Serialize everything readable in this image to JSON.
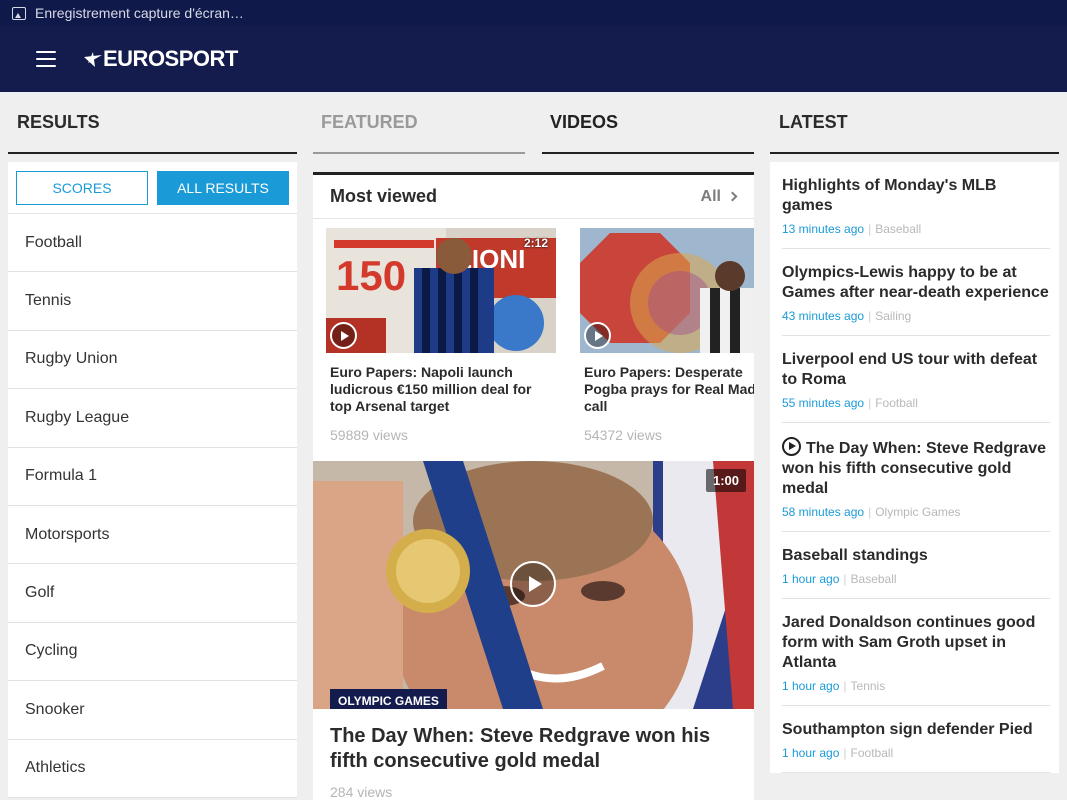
{
  "statusbar": {
    "text": "Enregistrement capture d'écran…",
    "icon": "image-icon"
  },
  "appbar": {
    "logo": "EUROSPORT",
    "menu_icon": "hamburger-menu-icon",
    "color": "#141b4d"
  },
  "results": {
    "heading": "RESULTS",
    "scores_label": "SCORES",
    "all_results_label": "ALL RESULTS",
    "sports": [
      "Football",
      "Tennis",
      "Rugby Union",
      "Rugby League",
      "Formula 1",
      "Motorsports",
      "Golf",
      "Cycling",
      "Snooker",
      "Athletics"
    ]
  },
  "tabs": {
    "featured": "FEATURED",
    "videos": "VIDEOS"
  },
  "most_viewed": {
    "title": "Most viewed",
    "all_label": "All",
    "items": [
      {
        "duration": "2:12",
        "caption": "Euro Papers: Napoli launch ludicrous €150 million deal for top Arsenal target",
        "views": "59889 views"
      },
      {
        "caption": "Euro Papers: Desperate Pogba prays for Real Madrid call",
        "views": "54372 views"
      }
    ]
  },
  "featured_video": {
    "duration": "1:00",
    "category": "OLYMPIC GAMES",
    "title": "The Day When: Steve Redgrave won his fifth consecutive gold medal",
    "views": "284 views"
  },
  "latest": {
    "heading": "LATEST",
    "items": [
      {
        "title": "Highlights of Monday's MLB games",
        "time": "13 minutes ago",
        "category": "Baseball",
        "video": false
      },
      {
        "title": "Olympics-Lewis happy to be at Games after near-death experience",
        "time": "43 minutes ago",
        "category": "Sailing",
        "video": false
      },
      {
        "title": "Liverpool end US tour with defeat to Roma",
        "time": "55 minutes ago",
        "category": "Football",
        "video": false
      },
      {
        "title": "The Day When: Steve Redgrave won his fifth consecutive gold medal",
        "time": "58 minutes ago",
        "category": "Olympic Games",
        "video": true
      },
      {
        "title": "Baseball standings",
        "time": "1 hour ago",
        "category": "Baseball",
        "video": false
      },
      {
        "title": "Jared Donaldson continues good form with Sam Groth upset in Atlanta",
        "time": "1 hour ago",
        "category": "Tennis",
        "video": false
      },
      {
        "title": "Southampton sign defender Pied",
        "time": "1 hour ago",
        "category": "Football",
        "video": false
      }
    ]
  },
  "colors": {
    "accent": "#1a9ad7",
    "navy": "#141b4d"
  }
}
